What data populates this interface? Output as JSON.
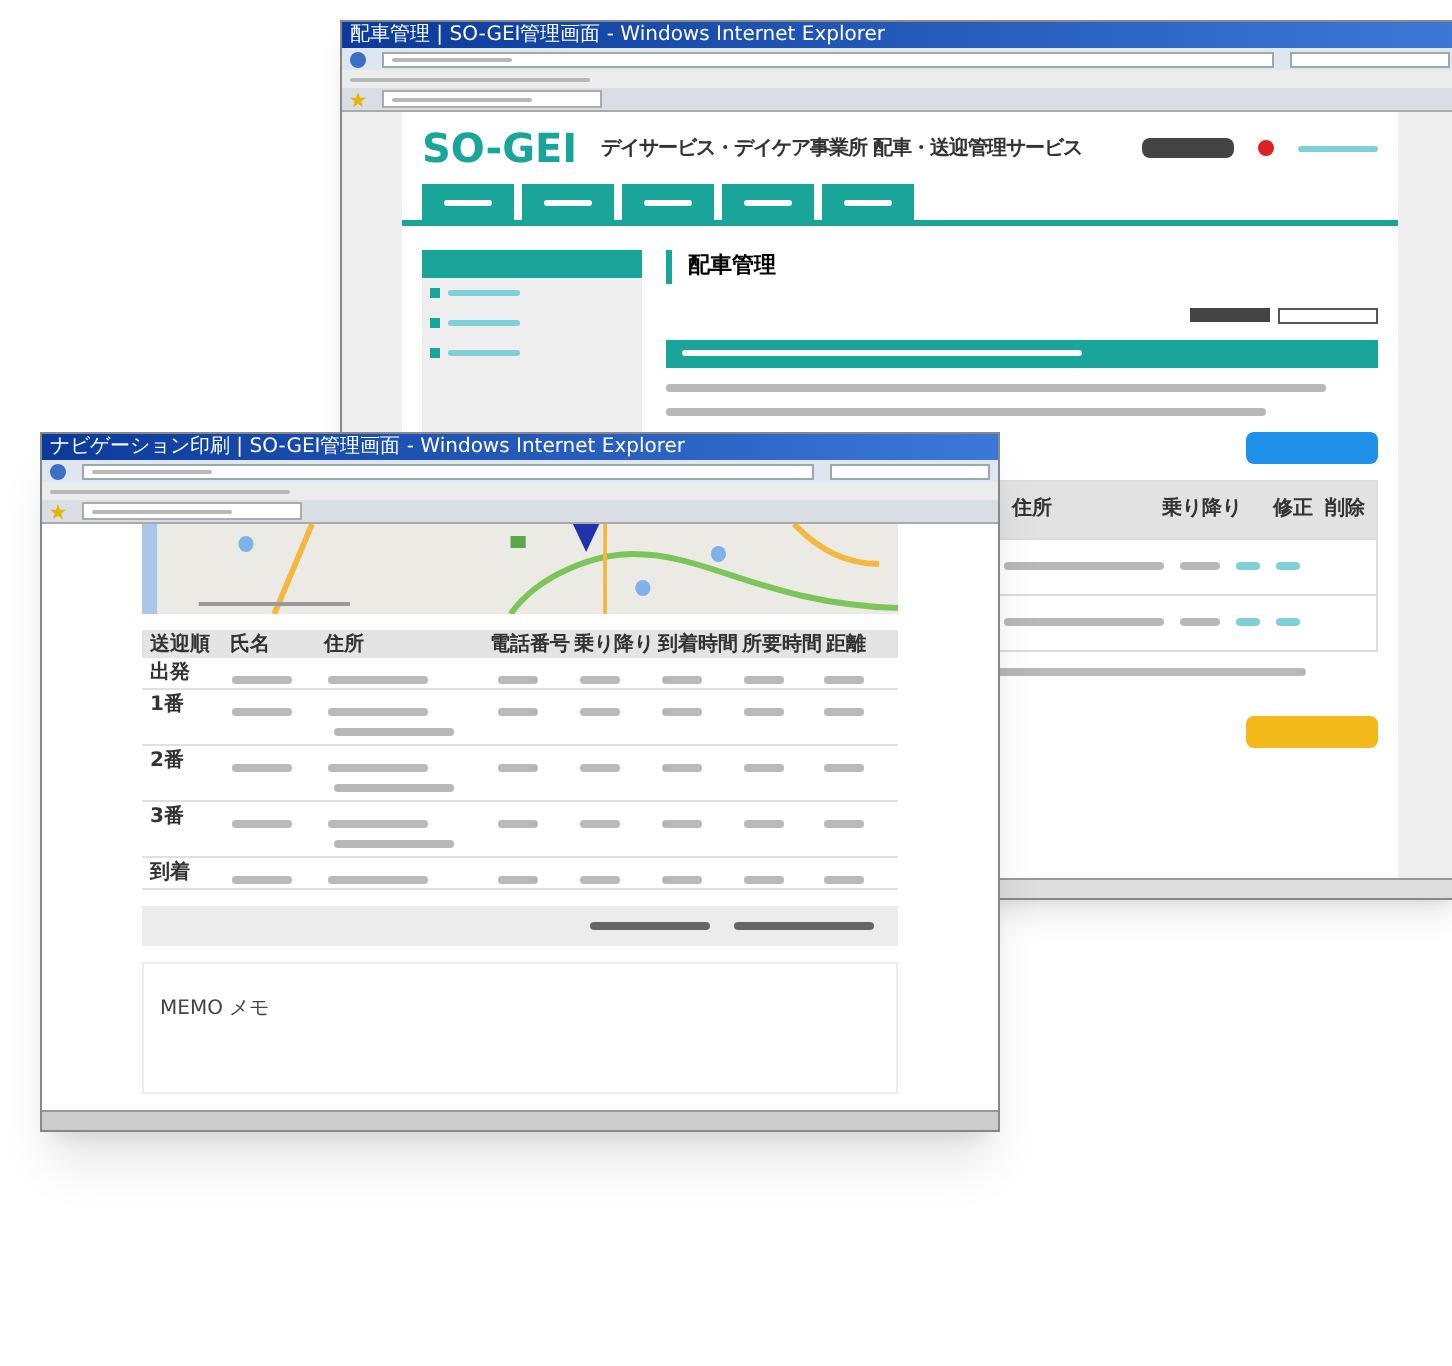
{
  "back_window": {
    "title": "配車管理 | SO-GEI管理画面 - Windows Internet Explorer",
    "logo": "SO-GEI",
    "tagline": "デイサービス・デイケア事業所 配車・送迎管理サービス",
    "heading": "配車管理",
    "table": {
      "columns": [
        "住所",
        "乗り降り",
        "修正",
        "削除"
      ]
    }
  },
  "front_window": {
    "title": "ナビゲーション印刷 | SO-GEI管理画面 - Windows Internet Explorer",
    "table": {
      "columns": [
        "送迎順",
        "氏名",
        "住所",
        "電話番号",
        "乗り降り",
        "到着時間",
        "所要時間",
        "距離"
      ],
      "rows": [
        {
          "stop": "出発",
          "has_note": false
        },
        {
          "stop": "1番",
          "has_note": true
        },
        {
          "stop": "2番",
          "has_note": true
        },
        {
          "stop": "3番",
          "has_note": true
        },
        {
          "stop": "到着",
          "has_note": false
        }
      ]
    },
    "memo": "MEMO メモ"
  }
}
